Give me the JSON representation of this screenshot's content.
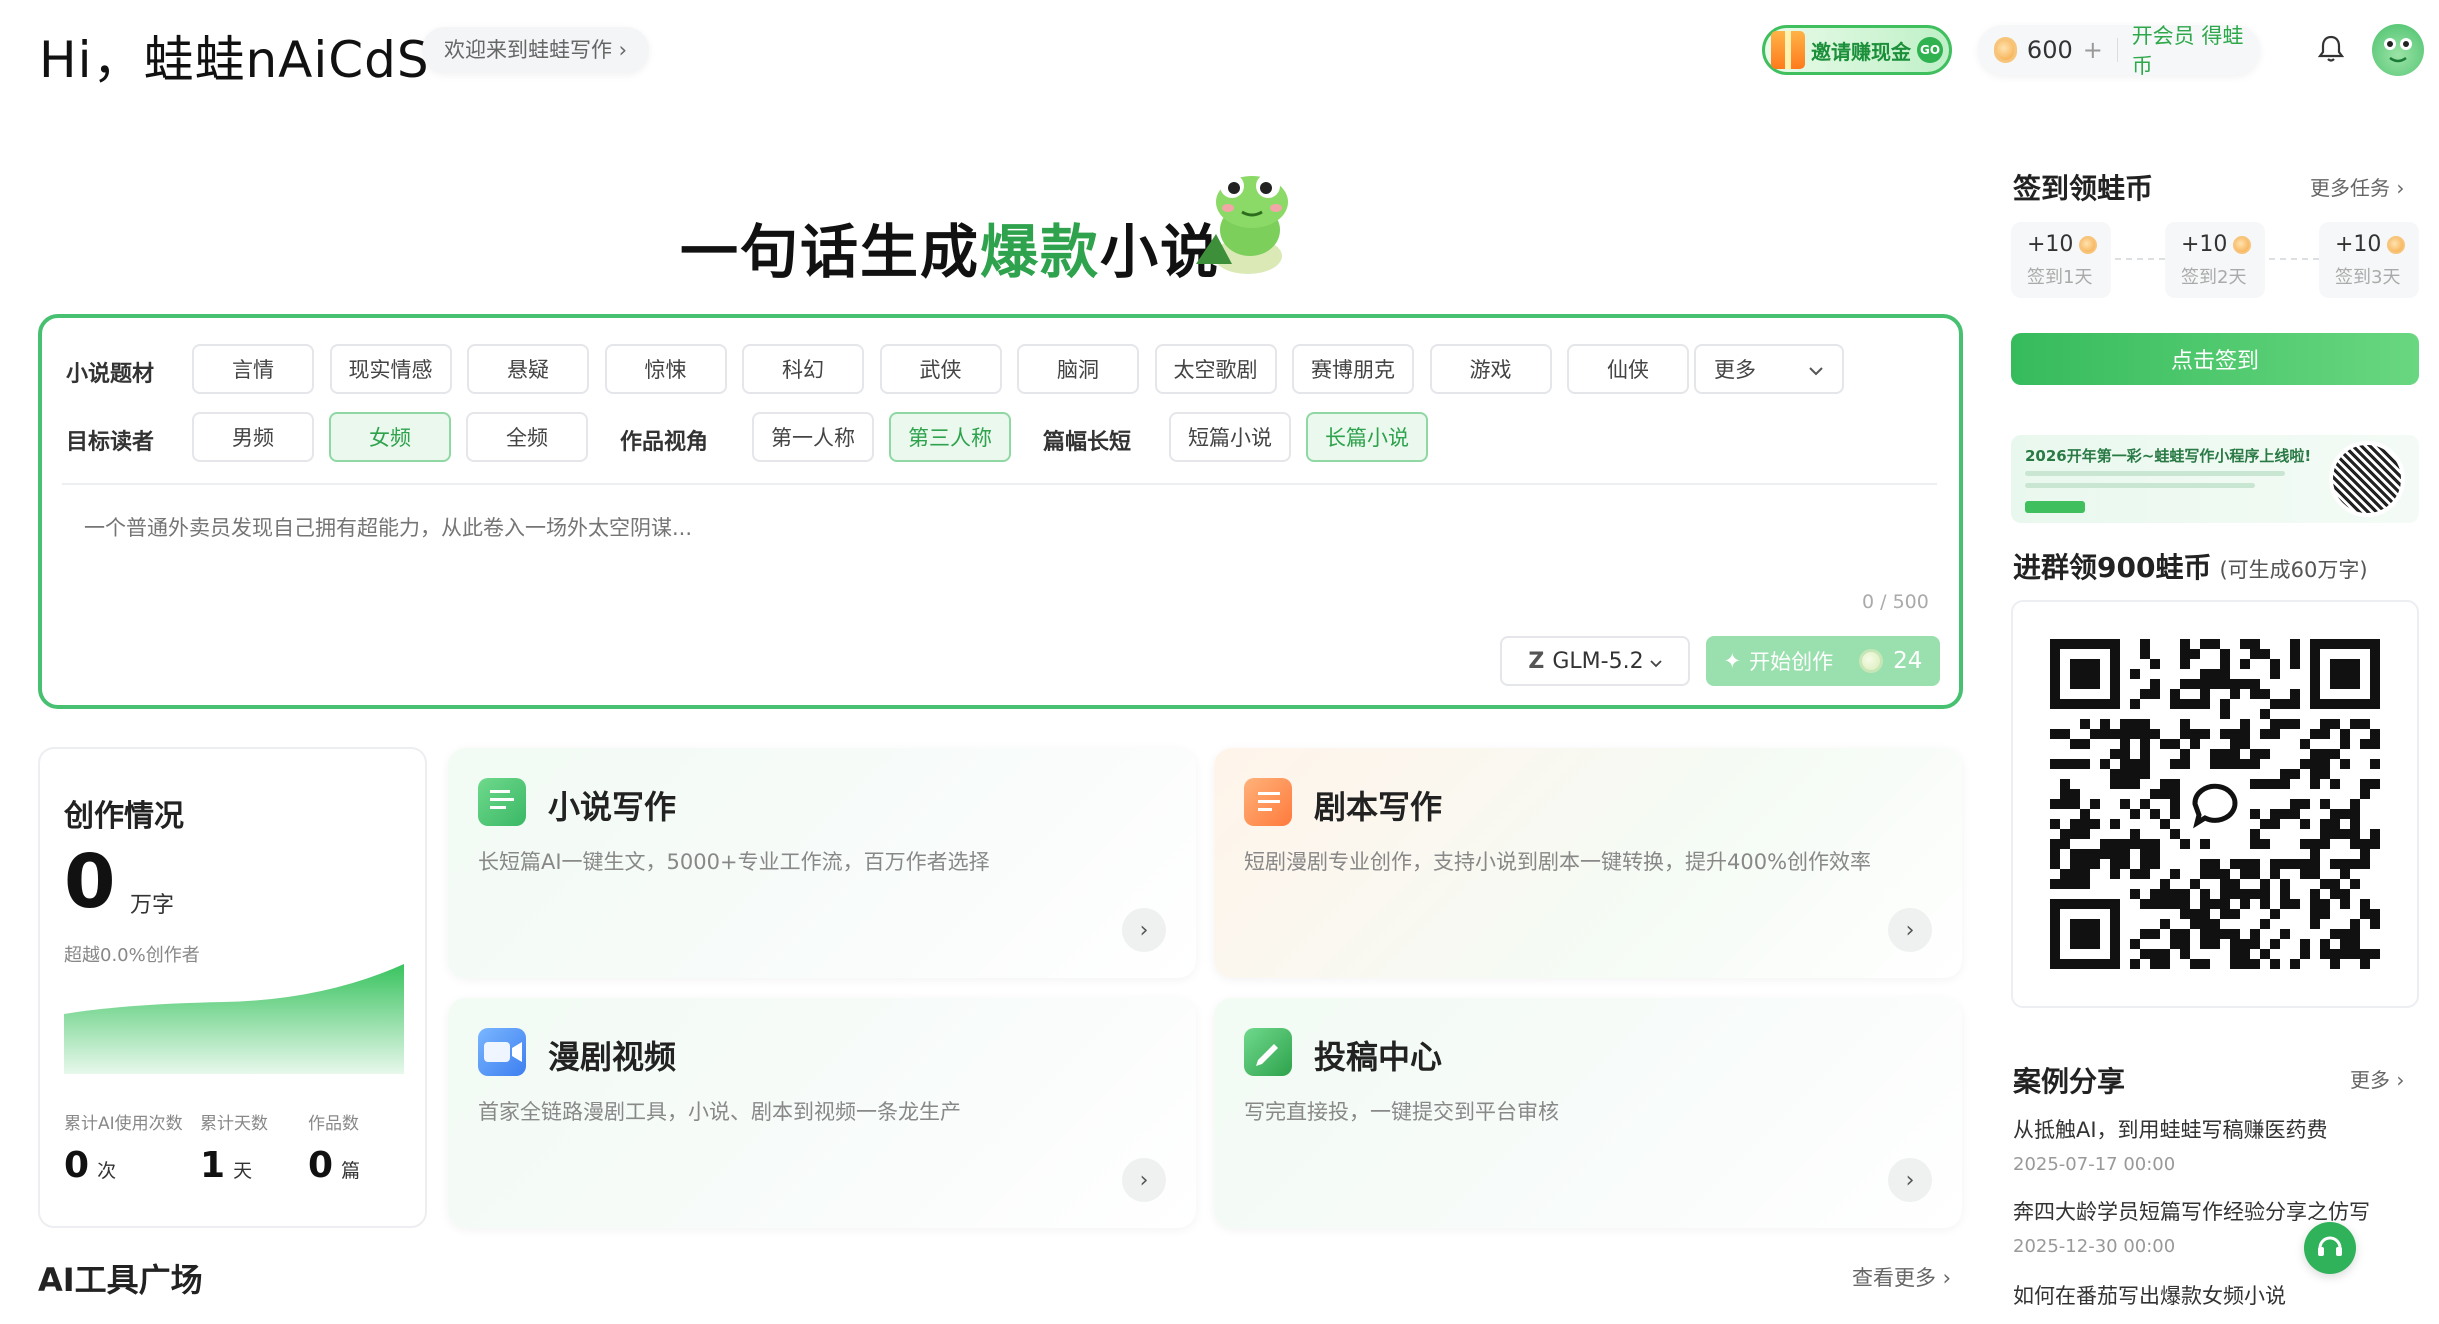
{
  "header": {
    "greeting": "Hi，蛙蛙nAiCdS",
    "welcome": "欢迎来到蛙蛙写作 ›",
    "invite_label": "邀请赚现金",
    "invite_go": "GO",
    "coins": "600",
    "coins_plus": "+",
    "vip_label": "开会员 得蛙币"
  },
  "hero": {
    "title_pre": "一句话生成",
    "title_hl": "爆款",
    "title_post": "小说"
  },
  "form": {
    "genre_label": "小说题材",
    "genres": [
      "言情",
      "现实情感",
      "悬疑",
      "惊悚",
      "科幻",
      "武侠",
      "脑洞",
      "太空歌剧",
      "赛博朋克",
      "游戏",
      "仙侠"
    ],
    "genre_more": "更多",
    "reader_label": "目标读者",
    "readers": [
      "男频",
      "女频",
      "全频"
    ],
    "reader_selected": "女频",
    "pov_label": "作品视角",
    "povs": [
      "第一人称",
      "第三人称"
    ],
    "length_label": "篇幅长短",
    "lengths": [
      "短篇小说",
      "长篇小说"
    ],
    "prompt_placeholder": "一个普通外卖员发现自己拥有超能力，从此卷入一场外太空阴谋...",
    "counter": "0 / 500",
    "model": "GLM-5.2",
    "model_logo": "Z",
    "start_label": "开始创作",
    "start_cost": "24"
  },
  "stats": {
    "title": "创作情况",
    "words": "0",
    "words_unit": "万字",
    "rank": "超越0.0%创作者",
    "ai_label": "累计AI使用次数",
    "ai_value": "0",
    "ai_unit": "次",
    "days_label": "累计天数",
    "days_value": "1",
    "days_unit": "天",
    "works_label": "作品数",
    "works_value": "0",
    "works_unit": "篇"
  },
  "features": [
    {
      "title": "小说写作",
      "desc": "长短篇AI一键生文，5000+专业工作流，百万作者选择",
      "icon": "document-icon"
    },
    {
      "title": "剧本写作",
      "desc": "短剧漫剧专业创作，支持小说到剧本一键转换，提升400%创作效率",
      "icon": "script-icon"
    },
    {
      "title": "漫剧视频",
      "desc": "首家全链路漫剧工具，小说、剧本到视频一条龙生产",
      "icon": "video-icon"
    },
    {
      "title": "投稿中心",
      "desc": "写完直接投，一键提交到平台审核",
      "icon": "submit-icon"
    }
  ],
  "tools": {
    "title": "AI工具广场",
    "more": "查看更多 ›"
  },
  "sidebar": {
    "sign_title": "签到领蛙币",
    "sign_more": "更多任务 ›",
    "days": [
      {
        "amount": "+10",
        "label": "签到1天"
      },
      {
        "amount": "+10",
        "label": "签到2天"
      },
      {
        "amount": "+10",
        "label": "签到3天"
      }
    ],
    "sign_button": "点击签到",
    "banner_title": "2026开年第一彩~蛙蛙写作小程序上线啦!",
    "group_title": "进群领900蛙币",
    "group_sub": "(可生成60万字)",
    "case_title": "案例分享",
    "case_more": "更多 ›",
    "cases": [
      {
        "title": "从抵触AI，到用蛙蛙写稿赚医药费",
        "date": "2025-07-17 00:00"
      },
      {
        "title": "奔四大龄学员短篇写作经验分享之仿写",
        "date": "2025-12-30 00:00"
      },
      {
        "title": "如何在番茄写出爆款女频小说",
        "date": ""
      }
    ]
  },
  "colors": {
    "brand": "#2ea24c",
    "accent": "#48c071",
    "coin": "#f5a640"
  }
}
